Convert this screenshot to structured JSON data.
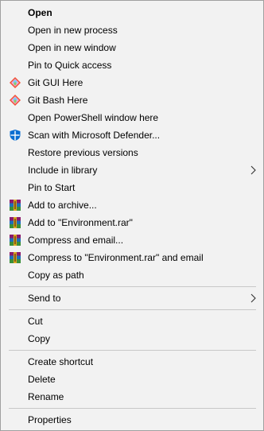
{
  "menu": {
    "items": [
      {
        "label": "Open"
      },
      {
        "label": "Open in new process"
      },
      {
        "label": "Open in new window"
      },
      {
        "label": "Pin to Quick access"
      },
      {
        "label": "Git GUI Here",
        "icon": "git-gui-icon"
      },
      {
        "label": "Git Bash Here",
        "icon": "git-bash-icon"
      },
      {
        "label": "Open PowerShell window here"
      },
      {
        "label": "Scan with Microsoft Defender...",
        "icon": "defender-shield-icon"
      },
      {
        "label": "Restore previous versions"
      },
      {
        "label": "Include in library",
        "submenu": true
      },
      {
        "label": "Pin to Start"
      },
      {
        "label": "Add to archive...",
        "icon": "winrar-icon"
      },
      {
        "label": "Add to \"Environment.rar\"",
        "icon": "winrar-icon"
      },
      {
        "label": "Compress and email...",
        "icon": "winrar-icon"
      },
      {
        "label": "Compress to \"Environment.rar\" and email",
        "icon": "winrar-icon"
      },
      {
        "label": "Copy as path"
      },
      {
        "label": "Send to",
        "submenu": true
      },
      {
        "label": "Cut"
      },
      {
        "label": "Copy"
      },
      {
        "label": "Create shortcut"
      },
      {
        "label": "Delete"
      },
      {
        "label": "Rename"
      },
      {
        "label": "Properties"
      }
    ]
  },
  "colors": {
    "menu_background": "#f2f2f2",
    "border": "#a0a0a0",
    "separator": "#c8c8c8",
    "text": "#000000"
  }
}
